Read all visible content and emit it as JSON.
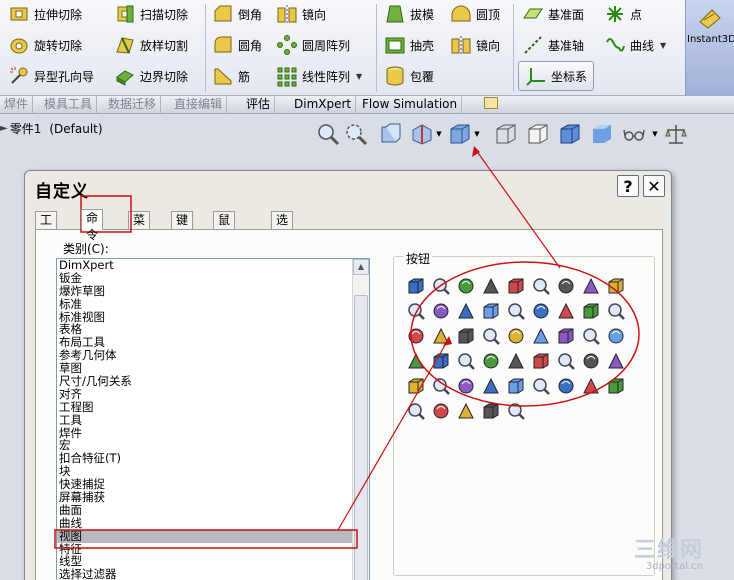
{
  "ribbon": {
    "col1": [
      "拉伸切除",
      "旋转切除",
      "异型孔向导"
    ],
    "col2": [
      "扫描切除",
      "放样切割",
      "边界切除"
    ],
    "col3": [
      "倒角",
      "圆角",
      "筋"
    ],
    "col4": [
      "镜向",
      "圆周阵列",
      "线性阵列"
    ],
    "col5": [
      "拔模",
      "抽壳",
      "包覆"
    ],
    "col6": [
      "圆顶",
      "镜向"
    ],
    "col7": [
      "基准面",
      "基准轴",
      "坐标系"
    ],
    "col8": [
      "点",
      "曲线"
    ],
    "instant3d": "Instant3D"
  },
  "cmdtabs": [
    "焊件",
    "模具工具",
    "数据迁移",
    "直接编辑",
    "评估",
    "DimXpert",
    "Flow Simulation"
  ],
  "part": {
    "name": "零件1",
    "config": "(Default)"
  },
  "dialog": {
    "title": "自定义",
    "help": "?",
    "close": "✕",
    "tabs": [
      "工具栏",
      "命令",
      "菜单",
      "键盘",
      "鼠标笔势",
      "选项"
    ],
    "category_label": "类别(C):",
    "categories": [
      "DimXpert",
      "钣金",
      "爆炸草图",
      "标准",
      "标准视图",
      "表格",
      "布局工具",
      "参考几何体",
      "草图",
      "尺寸/几何关系",
      "对齐",
      "工程图",
      "工具",
      "焊件",
      "宏",
      "扣合特征(T)",
      "块",
      "快速捕捉",
      "屏幕捕获",
      "曲面",
      "曲线",
      "视图",
      "特征",
      "线型",
      "选择过滤器"
    ],
    "selected_category": "视图",
    "buttons_label": "按钮"
  },
  "watermark": {
    "brand": "三维网",
    "url": "3dportal.cn"
  },
  "colors": {
    "annotation": "#cc1111",
    "selected": "#b8b8c0",
    "dialog_bg": "#ece9e2"
  }
}
